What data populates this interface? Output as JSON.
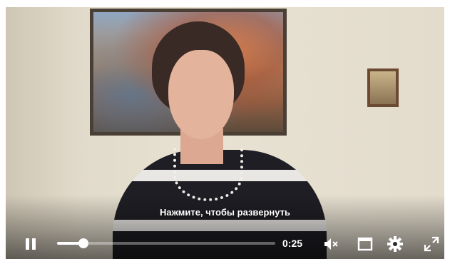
{
  "player": {
    "overlay_hint": "Нажмите, чтобы развернуть",
    "current_time": "0:25",
    "progress": 0.12,
    "icons": {
      "pause": "pause-icon",
      "mute": "volume-muted-icon",
      "miniplayer": "miniplayer-icon",
      "settings": "gear-icon",
      "fullscreen": "fullscreen-icon"
    }
  }
}
